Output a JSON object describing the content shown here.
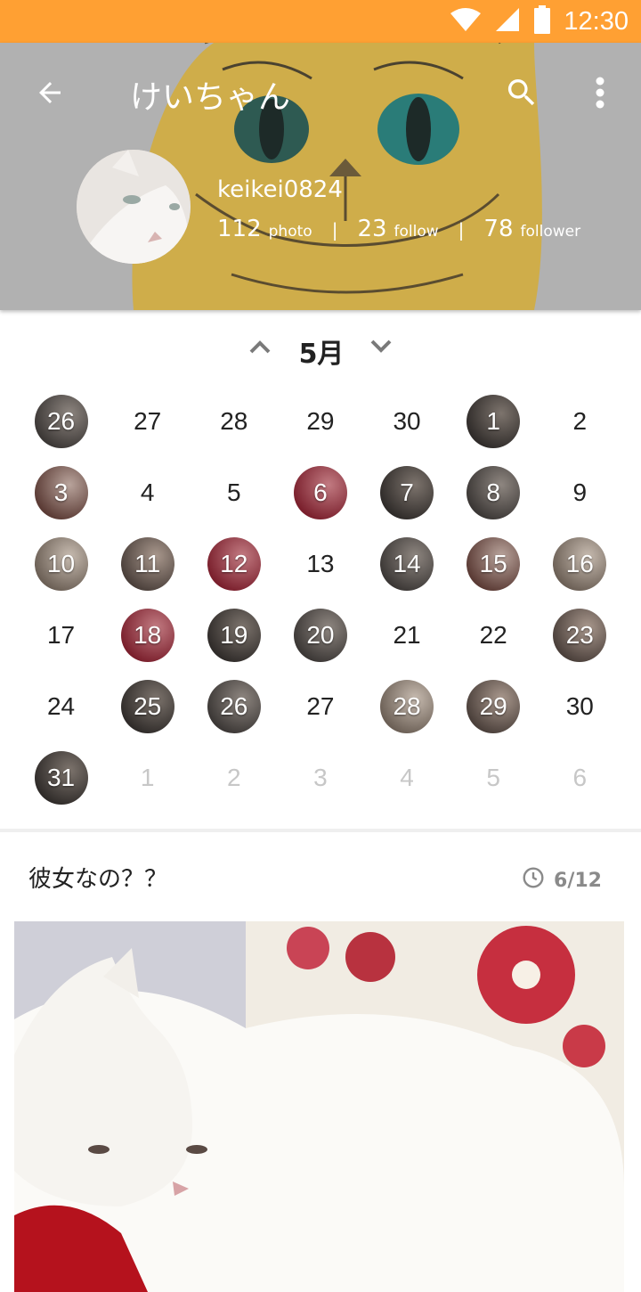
{
  "status_bar": {
    "time": "12:30",
    "background": "#ffa033"
  },
  "profile": {
    "title": "けいちゃん",
    "username": "keikei0824",
    "stats": [
      {
        "count": "112",
        "label": "photo"
      },
      {
        "count": "23",
        "label": "follow"
      },
      {
        "count": "78",
        "label": "follower"
      }
    ]
  },
  "calendar": {
    "month": "5月",
    "weeks": [
      [
        {
          "d": "26",
          "photo": true,
          "other": false
        },
        {
          "d": "27",
          "photo": false,
          "other": false
        },
        {
          "d": "28",
          "photo": false,
          "other": false
        },
        {
          "d": "29",
          "photo": false,
          "other": false
        },
        {
          "d": "30",
          "photo": false,
          "other": false
        },
        {
          "d": "1",
          "photo": true,
          "other": false
        },
        {
          "d": "2",
          "photo": false,
          "other": false
        }
      ],
      [
        {
          "d": "3",
          "photo": true,
          "other": false
        },
        {
          "d": "4",
          "photo": false,
          "other": false
        },
        {
          "d": "5",
          "photo": false,
          "other": false
        },
        {
          "d": "6",
          "photo": true,
          "other": false
        },
        {
          "d": "7",
          "photo": true,
          "other": false
        },
        {
          "d": "8",
          "photo": true,
          "other": false
        },
        {
          "d": "9",
          "photo": false,
          "other": false
        }
      ],
      [
        {
          "d": "10",
          "photo": true,
          "other": false
        },
        {
          "d": "11",
          "photo": true,
          "other": false
        },
        {
          "d": "12",
          "photo": true,
          "other": false
        },
        {
          "d": "13",
          "photo": false,
          "other": false
        },
        {
          "d": "14",
          "photo": true,
          "other": false
        },
        {
          "d": "15",
          "photo": true,
          "other": false
        },
        {
          "d": "16",
          "photo": true,
          "other": false
        }
      ],
      [
        {
          "d": "17",
          "photo": false,
          "other": false
        },
        {
          "d": "18",
          "photo": true,
          "other": false
        },
        {
          "d": "19",
          "photo": true,
          "other": false
        },
        {
          "d": "20",
          "photo": true,
          "other": false
        },
        {
          "d": "21",
          "photo": false,
          "other": false
        },
        {
          "d": "22",
          "photo": false,
          "other": false
        },
        {
          "d": "23",
          "photo": true,
          "other": false
        }
      ],
      [
        {
          "d": "24",
          "photo": false,
          "other": false
        },
        {
          "d": "25",
          "photo": true,
          "other": false
        },
        {
          "d": "26",
          "photo": true,
          "other": false
        },
        {
          "d": "27",
          "photo": false,
          "other": false
        },
        {
          "d": "28",
          "photo": true,
          "other": false
        },
        {
          "d": "29",
          "photo": true,
          "other": false
        },
        {
          "d": "30",
          "photo": false,
          "other": false
        }
      ],
      [
        {
          "d": "31",
          "photo": true,
          "other": false
        },
        {
          "d": "1",
          "photo": false,
          "other": true
        },
        {
          "d": "2",
          "photo": false,
          "other": true
        },
        {
          "d": "3",
          "photo": false,
          "other": true
        },
        {
          "d": "4",
          "photo": false,
          "other": true
        },
        {
          "d": "5",
          "photo": false,
          "other": true
        },
        {
          "d": "6",
          "photo": false,
          "other": true
        }
      ]
    ]
  },
  "post": {
    "title": "彼女なの？？",
    "date": "6/12"
  },
  "icons": [
    "wifi-icon",
    "signal-icon",
    "battery-icon",
    "back-arrow-icon",
    "search-icon",
    "more-vert-icon",
    "chevron-up-icon",
    "chevron-down-icon",
    "clock-icon"
  ]
}
